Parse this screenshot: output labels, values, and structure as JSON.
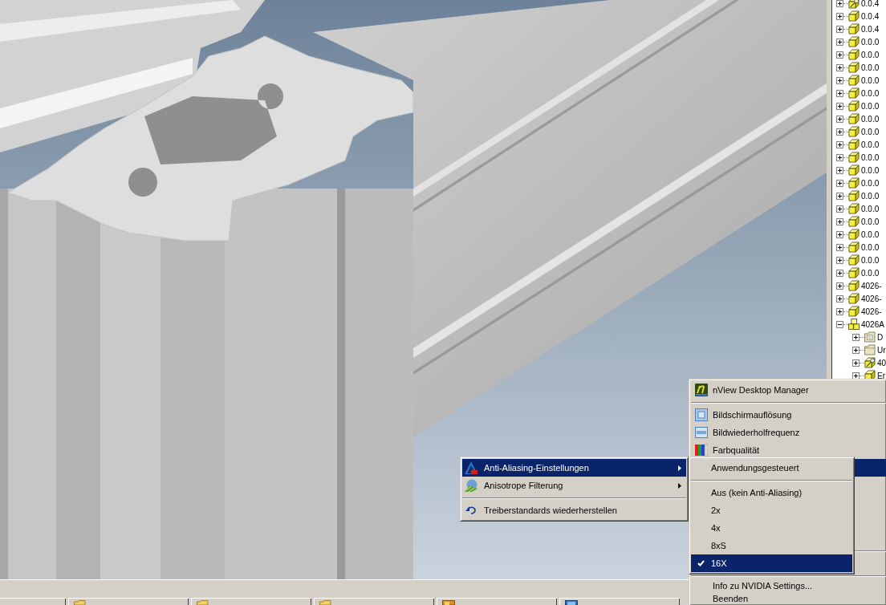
{
  "tree": {
    "items": [
      {
        "label": "0.0.4",
        "kind": "pinned-part",
        "expanded": false
      },
      {
        "label": "0.0.4",
        "kind": "part",
        "expanded": false
      },
      {
        "label": "0.0.4",
        "kind": "part",
        "expanded": false
      },
      {
        "label": "0.0.0",
        "kind": "part",
        "expanded": false
      },
      {
        "label": "0.0.0",
        "kind": "part",
        "expanded": false
      },
      {
        "label": "0.0.0",
        "kind": "part",
        "expanded": false
      },
      {
        "label": "0.0.0",
        "kind": "part",
        "expanded": false
      },
      {
        "label": "0.0.0",
        "kind": "part",
        "expanded": false
      },
      {
        "label": "0.0.0",
        "kind": "part",
        "expanded": false
      },
      {
        "label": "0.0.0",
        "kind": "part",
        "expanded": false
      },
      {
        "label": "0.0.0",
        "kind": "part",
        "expanded": false
      },
      {
        "label": "0.0.0",
        "kind": "part",
        "expanded": false
      },
      {
        "label": "0.0.0",
        "kind": "part",
        "expanded": false
      },
      {
        "label": "0.0.0",
        "kind": "part",
        "expanded": false
      },
      {
        "label": "0.0.0",
        "kind": "part",
        "expanded": false
      },
      {
        "label": "0.0.0",
        "kind": "part",
        "expanded": false
      },
      {
        "label": "0.0.0",
        "kind": "part",
        "expanded": false
      },
      {
        "label": "0.0.0",
        "kind": "part",
        "expanded": false
      },
      {
        "label": "0.0.0",
        "kind": "part",
        "expanded": false
      },
      {
        "label": "0.0.0",
        "kind": "part",
        "expanded": false
      },
      {
        "label": "0.0.0",
        "kind": "part",
        "expanded": false
      },
      {
        "label": "0.0.0",
        "kind": "part",
        "expanded": false
      },
      {
        "label": "4026-",
        "kind": "part",
        "expanded": false
      },
      {
        "label": "4026-",
        "kind": "part",
        "expanded": false
      },
      {
        "label": "4026-",
        "kind": "part",
        "expanded": false
      },
      {
        "label": "4026A",
        "kind": "assembly",
        "expanded": true,
        "children": [
          {
            "label": "D",
            "kind": "folder-doc",
            "expanded": false
          },
          {
            "label": "Ur",
            "kind": "folder",
            "expanded": false
          },
          {
            "label": "40",
            "kind": "pinned-part",
            "expanded": false
          },
          {
            "label": "Er",
            "kind": "part",
            "expanded": false
          }
        ]
      }
    ]
  },
  "tray_menu": {
    "items": [
      {
        "kind": "nview",
        "label": "nView Desktop Manager",
        "selected": false
      },
      {
        "kind": "separator"
      },
      {
        "kind": "resolution",
        "label": "Bildschirmauflösung",
        "selected": false
      },
      {
        "kind": "refresh",
        "label": "Bildwiederholfrequenz",
        "selected": false
      },
      {
        "kind": "colors",
        "label": "Farbqualität",
        "selected": false
      },
      {
        "kind": "plain",
        "selected": true
      },
      {
        "kind": "separator"
      },
      {
        "kind": "separator"
      },
      {
        "kind": "plain",
        "label": "Info zu NVIDIA Settings...",
        "selected": false
      },
      {
        "kind": "plain",
        "label": "Beenden",
        "selected": false
      }
    ]
  },
  "quality_submenu": {
    "items": [
      {
        "kind": "antialiasing",
        "label": "Anti-Aliasing-Einstellungen",
        "submenu": true,
        "selected": true
      },
      {
        "kind": "anisotropic",
        "label": "Anisotrope Filterung",
        "submenu": true,
        "selected": false
      },
      {
        "kind": "separator"
      },
      {
        "kind": "undo",
        "label": "Treiberstandards wiederherstellen",
        "submenu": false,
        "selected": false
      }
    ]
  },
  "antialiasing_submenu": {
    "items": [
      {
        "kind": "item",
        "label": "Anwendungsgesteuert",
        "checked": false,
        "selected": false
      },
      {
        "kind": "separator"
      },
      {
        "kind": "item",
        "label": "Aus (kein Anti-Aliasing)",
        "checked": false,
        "selected": false
      },
      {
        "kind": "item",
        "label": "2x",
        "checked": false,
        "selected": false
      },
      {
        "kind": "item",
        "label": "4x",
        "checked": false,
        "selected": false
      },
      {
        "kind": "item",
        "label": "8xS",
        "checked": false,
        "selected": false
      },
      {
        "kind": "item",
        "label": "16X",
        "checked": true,
        "selected": true
      }
    ]
  },
  "taskbar": {
    "buttons": [
      {
        "kind": "plain"
      },
      {
        "kind": "folder"
      },
      {
        "kind": "folder"
      },
      {
        "kind": "folder"
      },
      {
        "kind": "orange-app"
      },
      {
        "kind": "blue-app"
      }
    ]
  }
}
